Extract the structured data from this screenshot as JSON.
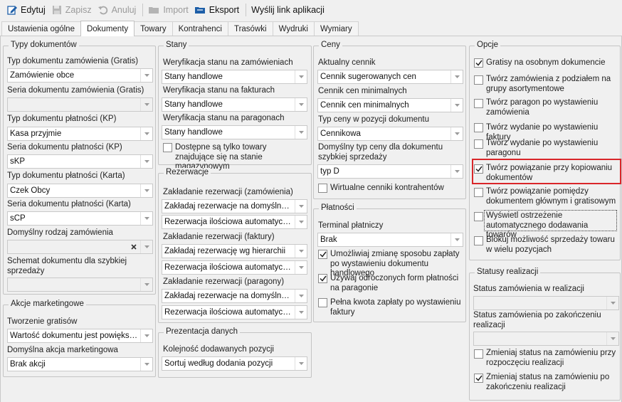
{
  "toolbar": {
    "edit": "Edytuj",
    "save": "Zapisz",
    "cancel": "Anuluj",
    "import": "Import",
    "export": "Eksport",
    "send_link": "Wyślij link aplikacji"
  },
  "tabs": [
    "Ustawienia ogólne",
    "Dokumenty",
    "Towary",
    "Kontrahenci",
    "Trasówki",
    "Wydruki",
    "Wymiary"
  ],
  "active_tab": "Dokumenty",
  "typy_dokumentow": {
    "title": "Typy dokumentów",
    "typ_zam_gratis_label": "Typ dokumentu zamówienia (Gratis)",
    "typ_zam_gratis_value": "Zamówienie obce",
    "seria_zam_gratis_label": "Seria dokumentu zamówienia (Gratis)",
    "seria_zam_gratis_value": "",
    "typ_plat_kp_label": "Typ dokumentu płatności (KP)",
    "typ_plat_kp_value": "Kasa przyjmie",
    "seria_plat_kp_label": "Seria dokumentu płatności (KP)",
    "seria_plat_kp_value": "sKP",
    "typ_plat_karta_label": "Typ dokumentu płatności (Karta)",
    "typ_plat_karta_value": "Czek Obcy",
    "seria_plat_karta_label": "Seria dokumentu płatności (Karta)",
    "seria_plat_karta_value": "sCP",
    "rodzaj_zam_label": "Domyślny rodzaj zamówienia",
    "rodzaj_zam_value": "",
    "schemat_label": "Schemat dokumentu dla szybkiej sprzedaży",
    "schemat_value": ""
  },
  "akcje": {
    "title": "Akcje marketingowe",
    "tworzenie_label": "Tworzenie gratisów",
    "tworzenie_value": "Wartość dokumentu jest powiększa...",
    "domyslna_label": "Domyślna akcja marketingowa",
    "domyslna_value": "Brak akcji"
  },
  "stany": {
    "title": "Stany",
    "wer_zam_label": "Weryfikacja stanu na zamówieniach",
    "wer_zam_value": "Stany handlowe",
    "wer_fak_label": "Weryfikacja stanu na fakturach",
    "wer_fak_value": "Stany handlowe",
    "wer_par_label": "Weryfikacja stanu na paragonach",
    "wer_par_value": "Stany handlowe",
    "dostepne_label": "Dostępne są tylko towary znajdujące się na stanie magazynowym"
  },
  "rezerwacje": {
    "title": "Rezerwacje",
    "zak_zam_label": "Zakładanie rezerwacji (zamówienia)",
    "zak_zam_value1": "Zakładaj rezerwacje na domyślnym ...",
    "zak_zam_value2": "Rezerwacja ilościowa automatyczna",
    "zak_fak_label": "Zakładanie rezerwacji (faktury)",
    "zak_fak_value1": "Zakładaj rezerwację wg hierarchii",
    "zak_fak_value2": "Rezerwacja ilościowa automatyczna",
    "zak_par_label": "Zakładanie rezerwacji (paragony)",
    "zak_par_value1": "Zakładaj rezerwacje na domyślnym ...",
    "zak_par_value2": "Rezerwacja ilościowa automatyczna"
  },
  "prezentacja": {
    "title": "Prezentacja danych",
    "kolejnosc_label": "Kolejność dodawanych pozycji",
    "kolejnosc_value": "Sortuj według dodania pozycji"
  },
  "ceny": {
    "title": "Ceny",
    "aktualny_label": "Aktualny cennik",
    "aktualny_value": "Cennik sugerowanych cen",
    "minimalne_label": "Cennik cen minimalnych",
    "minimalne_value": "Cennik cen minimalnych",
    "typ_ceny_label": "Typ ceny w pozycji dokumentu",
    "typ_ceny_value": "Cennikowa",
    "domyslny_typ_label": "Domyślny typ ceny dla dokumentu szybkiej sprzedaży",
    "domyslny_typ_value": "typ D",
    "wirtualne_label": "Wirtualne cenniki kontrahentów"
  },
  "platnosci": {
    "title": "Płatności",
    "terminal_label": "Terminal płatniczy",
    "terminal_value": "Brak",
    "zmiana_label": "Umożliwiaj zmianę sposobu zapłaty po wystawieniu dokumentu handlowego",
    "odroczone_label": "Używaj odroczonych form płatności na paragonie",
    "pelna_label": "Pełna kwota zapłaty po wystawieniu faktury"
  },
  "opcje": {
    "title": "Opcje",
    "items": [
      {
        "label": "Gratisy na osobnym dokumencie",
        "checked": true
      },
      {
        "label": "Twórz zamówienia z podziałem na grupy asortymentowe",
        "checked": false
      },
      {
        "label": "Twórz paragon po wystawieniu zamówienia",
        "checked": false
      },
      {
        "label": "Twórz wydanie po wystawieniu faktury",
        "checked": false
      },
      {
        "label": "Twórz wydanie po wystawieniu paragonu",
        "checked": false
      },
      {
        "label": "Twórz powiązanie przy kopiowaniu dokumentów",
        "checked": true
      },
      {
        "label": "Twórz powiązanie pomiędzy dokumentem głównym i gratisowym",
        "checked": false
      },
      {
        "label": "Wyświetl ostrzeżenie automatycznego dodawania towarów",
        "checked": false
      },
      {
        "label": "Blokuj możliwość sprzedaży towaru w wielu pozycjach",
        "checked": false
      }
    ]
  },
  "statusy": {
    "title": "Statusy realizacji",
    "status_real_label": "Status zamówienia w realizacji",
    "status_real_value": "",
    "status_zak_label": "Status zamówienia po zakończeniu realizacji",
    "status_zak_value": "",
    "zmieniaj_rozp_label": "Zmieniaj status na zamówieniu przy rozpoczęciu realizacji",
    "zmieniaj_rozp_checked": false,
    "zmieniaj_zak_label": "Zmieniaj status na zamówieniu po zakończeniu realizacji",
    "zmieniaj_zak_checked": true
  },
  "colors": {
    "highlight": "#d9262a",
    "accent_blue": "#1e5fa8"
  }
}
